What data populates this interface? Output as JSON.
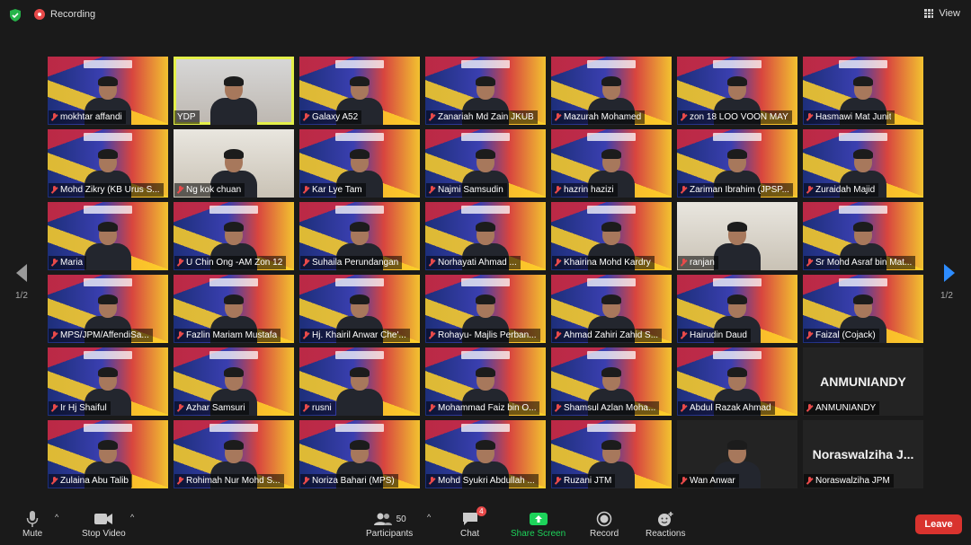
{
  "header": {
    "recording_label": "Recording",
    "view_label": "View"
  },
  "pagination": {
    "left": "1/2",
    "right": "1/2"
  },
  "participants": [
    {
      "name": "mokhtar affandi",
      "muted": true,
      "bg": "poster"
    },
    {
      "name": "YDP",
      "muted": false,
      "bg": "room",
      "active": true
    },
    {
      "name": "Galaxy A52",
      "muted": true,
      "bg": "poster"
    },
    {
      "name": "Zanariah Md Zain JKUB",
      "muted": true,
      "bg": "poster"
    },
    {
      "name": "Mazurah Mohamed",
      "muted": true,
      "bg": "poster"
    },
    {
      "name": "zon 18 LOO VOON MAY",
      "muted": true,
      "bg": "poster"
    },
    {
      "name": "Hasmawi Mat Junit",
      "muted": true,
      "bg": "poster"
    },
    {
      "name": "Mohd Zikry (KB Urus S...",
      "muted": true,
      "bg": "poster"
    },
    {
      "name": "Ng kok chuan",
      "muted": true,
      "bg": "office"
    },
    {
      "name": "Kar Lye Tam",
      "muted": true,
      "bg": "poster"
    },
    {
      "name": "Najmi Samsudin",
      "muted": true,
      "bg": "poster"
    },
    {
      "name": "hazrin hazizi",
      "muted": true,
      "bg": "poster"
    },
    {
      "name": "Zariman Ibrahim (JPSP...",
      "muted": true,
      "bg": "poster"
    },
    {
      "name": "Zuraidah Majid",
      "muted": true,
      "bg": "poster"
    },
    {
      "name": "Maria",
      "muted": true,
      "bg": "poster"
    },
    {
      "name": "U Chin Ong -AM Zon 12",
      "muted": true,
      "bg": "poster"
    },
    {
      "name": "Suhaila Perundangan",
      "muted": true,
      "bg": "poster"
    },
    {
      "name": "Norhayati Ahmad ...",
      "muted": true,
      "bg": "poster"
    },
    {
      "name": "Khairina Mohd Kardry",
      "muted": true,
      "bg": "poster"
    },
    {
      "name": "ranjan",
      "muted": true,
      "bg": "office"
    },
    {
      "name": "Sr Mohd Asraf bin Mat...",
      "muted": true,
      "bg": "poster"
    },
    {
      "name": "MPS/JPM/AffendiSa...",
      "muted": true,
      "bg": "poster"
    },
    {
      "name": "Fazlin Mariam Mustafa",
      "muted": true,
      "bg": "poster"
    },
    {
      "name": "Hj. Khairil Anwar Che'...",
      "muted": true,
      "bg": "poster"
    },
    {
      "name": "Rohayu- Majlis Perban...",
      "muted": true,
      "bg": "poster"
    },
    {
      "name": "Ahmad Zahiri Zahid S...",
      "muted": true,
      "bg": "poster"
    },
    {
      "name": "Hairudin Daud",
      "muted": true,
      "bg": "poster"
    },
    {
      "name": "Faizal (Cojack)",
      "muted": true,
      "bg": "poster"
    },
    {
      "name": "Ir Hj Shaiful",
      "muted": true,
      "bg": "poster"
    },
    {
      "name": "Azhar Samsuri",
      "muted": true,
      "bg": "poster"
    },
    {
      "name": "rusni",
      "muted": true,
      "bg": "poster"
    },
    {
      "name": "Mohammad Faiz bin O...",
      "muted": true,
      "bg": "poster"
    },
    {
      "name": "Shamsul Azlan Moha...",
      "muted": true,
      "bg": "poster"
    },
    {
      "name": "Abdul Razak Ahmad",
      "muted": true,
      "bg": "poster"
    },
    {
      "name": "ANMUNIANDY",
      "muted": true,
      "bg": "black",
      "big_name": "ANMUNIANDY"
    },
    {
      "name": "Zulaina Abu Talib",
      "muted": true,
      "bg": "poster"
    },
    {
      "name": "Rohimah Nur Mohd S...",
      "muted": true,
      "bg": "poster"
    },
    {
      "name": "Noriza Bahari (MPS)",
      "muted": true,
      "bg": "poster"
    },
    {
      "name": "Mohd Syukri Abdullah ...",
      "muted": true,
      "bg": "poster"
    },
    {
      "name": "Ruzani JTM",
      "muted": true,
      "bg": "poster"
    },
    {
      "name": "Wan Anwar",
      "muted": true,
      "bg": "black"
    },
    {
      "name": "Noraswalziha JPM",
      "muted": true,
      "bg": "black",
      "big_name": "Noraswalziha J..."
    }
  ],
  "toolbar": {
    "mute": "Mute",
    "stop_video": "Stop Video",
    "participants": "Participants",
    "participants_count": "50",
    "chat": "Chat",
    "chat_badge": "4",
    "share_screen": "Share Screen",
    "record": "Record",
    "reactions": "Reactions",
    "leave": "Leave"
  },
  "colors": {
    "active_speaker": "#e4f04a",
    "leave": "#d9332e",
    "share": "#1dd35a",
    "muted_mic": "#e84a4a"
  }
}
